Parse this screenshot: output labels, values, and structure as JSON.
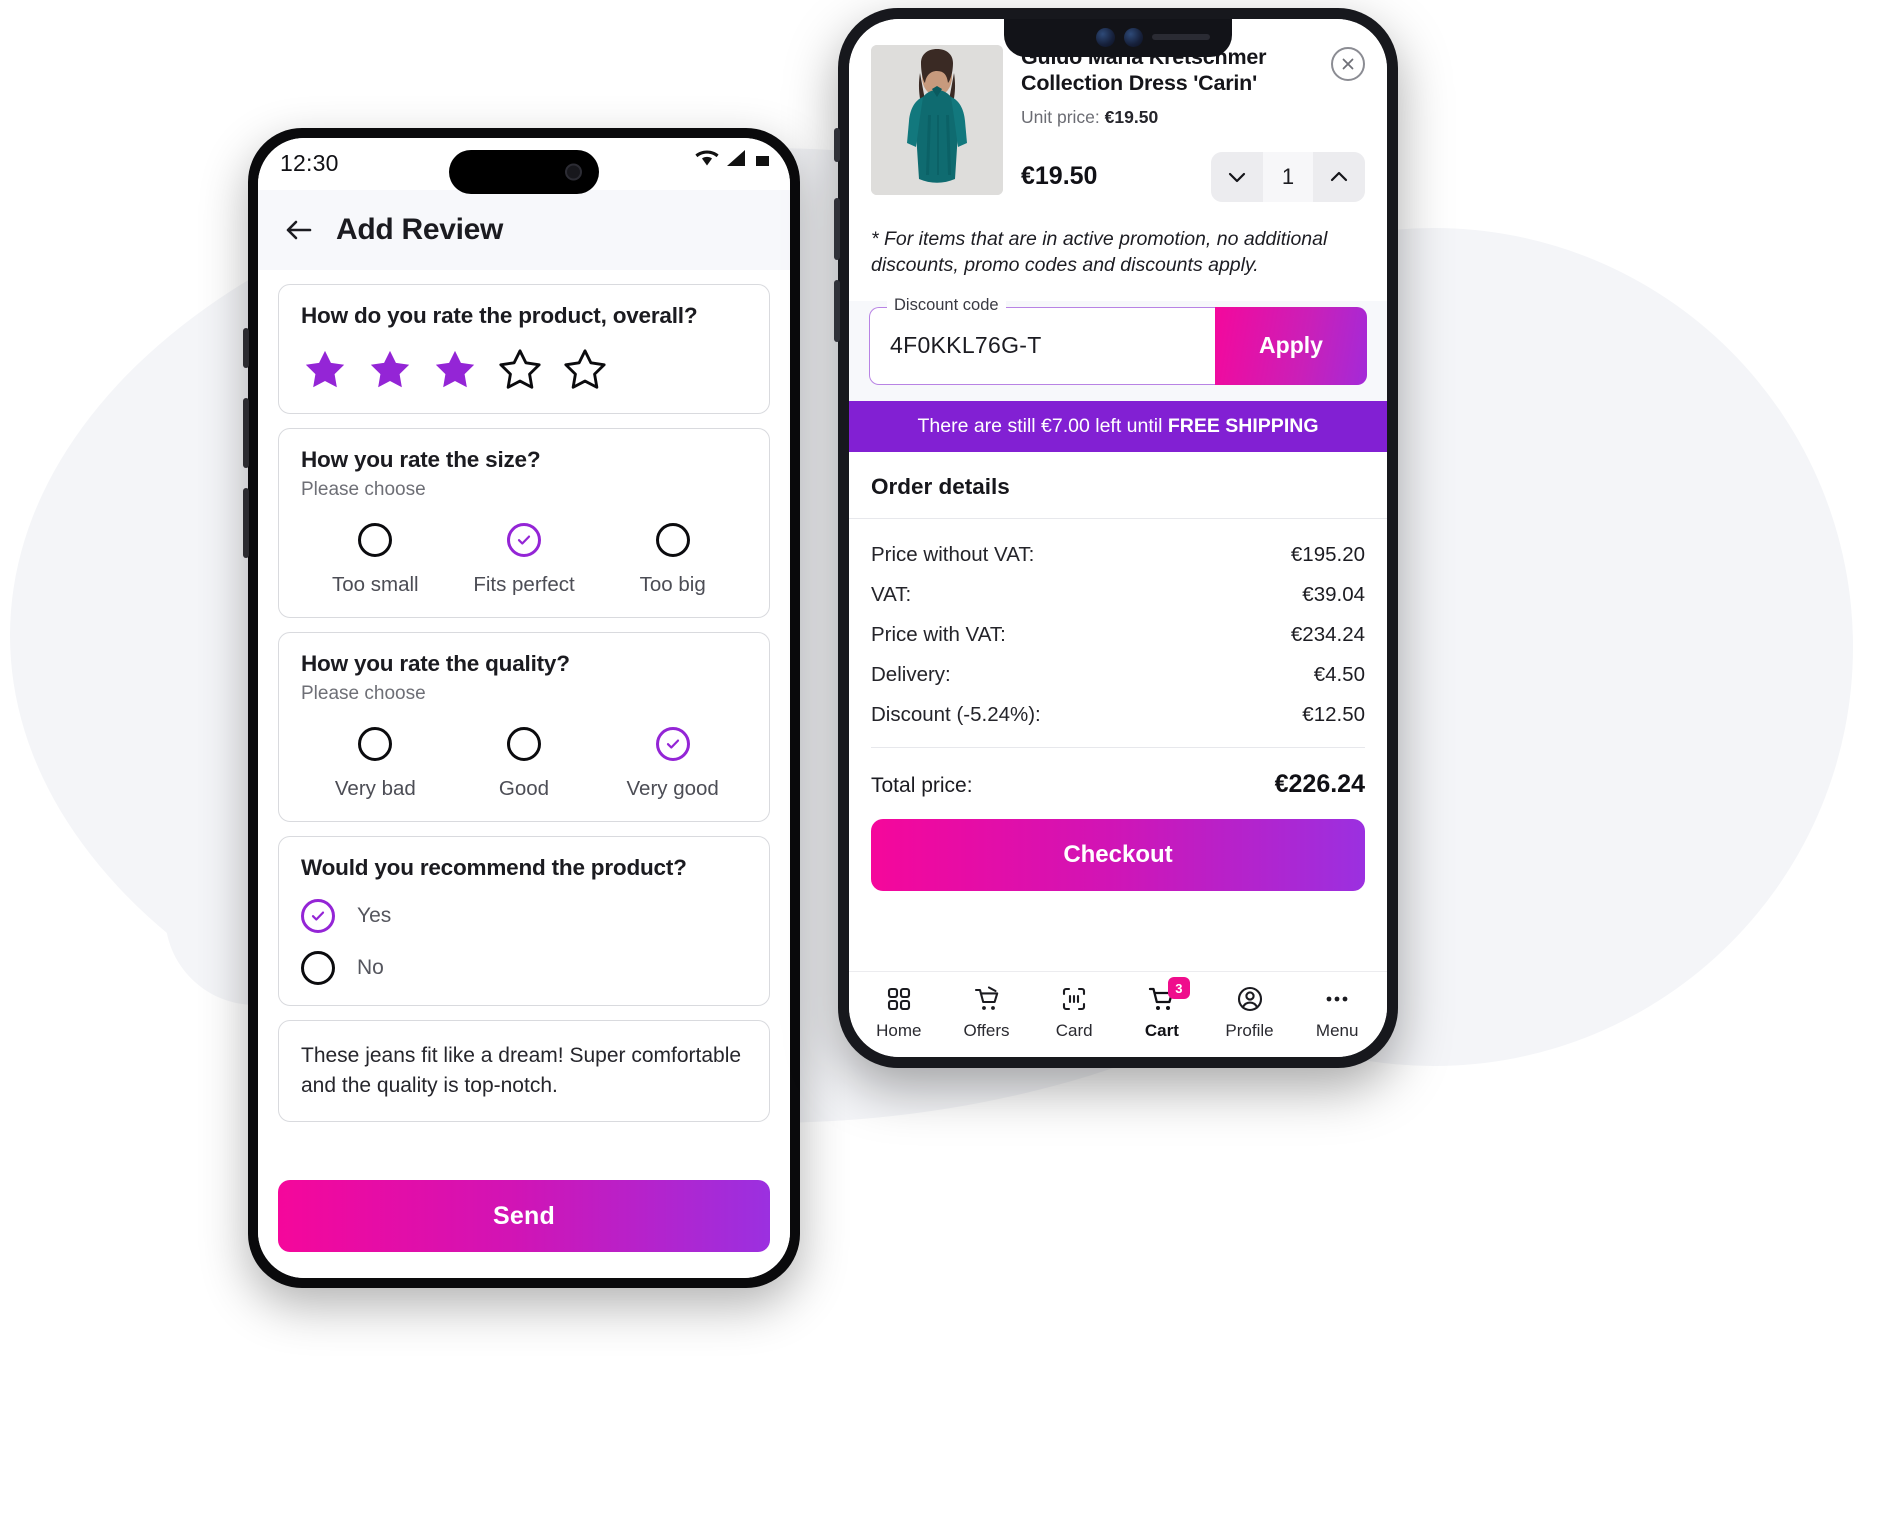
{
  "review_screen": {
    "status_bar": {
      "time": "12:30",
      "icons": [
        "wifi-icon",
        "signal-icon",
        "battery-icon"
      ]
    },
    "app_bar": {
      "back_icon": "arrow-left-icon",
      "title": "Add Review"
    },
    "overall": {
      "question": "How do you rate the product, overall?",
      "rating": 3,
      "max_rating": 5,
      "star_color": "#9425d6"
    },
    "size": {
      "question": "How you rate the size?",
      "hint": "Please choose",
      "options": [
        "Too small",
        "Fits perfect",
        "Too big"
      ],
      "selected_index": 1
    },
    "quality": {
      "question": "How you rate the quality?",
      "hint": "Please choose",
      "options": [
        "Very bad",
        "Good",
        "Very good"
      ],
      "selected_index": 2
    },
    "recommend": {
      "question": "Would you recommend the product?",
      "options": [
        "Yes",
        "No"
      ],
      "selected_index": 0
    },
    "review_text": "These jeans fit like a dream! Super comfortable and the quality is top-notch.",
    "send_label": "Send"
  },
  "cart_screen": {
    "product": {
      "name": "Guido Maria Kretschmer Collection Dress 'Carin'",
      "unit_price_label": "Unit price:",
      "unit_price": "€19.50",
      "price": "€19.50",
      "quantity": "1",
      "decrease_icon": "chevron-down-icon",
      "increase_icon": "chevron-up-icon",
      "remove_icon": "close-circle-icon"
    },
    "promo_note": "* For items that are in active promotion, no additional discounts, promo codes and discounts apply.",
    "discount": {
      "legend": "Discount code",
      "value": "4F0KKL76G-T",
      "placeholder": "Discount code",
      "apply_label": "Apply"
    },
    "shipping_banner": {
      "text_before": "There are still €7.00 left until ",
      "highlight": "FREE SHIPPING",
      "background": "#8220d3"
    },
    "order_details": {
      "title": "Order details",
      "rows": [
        {
          "label": "Price without VAT:",
          "value": "€195.20"
        },
        {
          "label": "VAT:",
          "value": "€39.04"
        },
        {
          "label": "Price with VAT:",
          "value": "€234.24"
        },
        {
          "label": "Delivery:",
          "value": "€4.50"
        },
        {
          "label": "Discount (-5.24%):",
          "value": "€12.50"
        }
      ],
      "total_label": "Total price:",
      "total_value": "€226.24"
    },
    "checkout_label": "Checkout",
    "tabs": [
      {
        "label": "Home",
        "icon": "grid-icon",
        "active": false,
        "badge": ""
      },
      {
        "label": "Offers",
        "icon": "offers-tag-icon",
        "active": false,
        "badge": ""
      },
      {
        "label": "Card",
        "icon": "scan-card-icon",
        "active": false,
        "badge": ""
      },
      {
        "label": "Cart",
        "icon": "cart-icon",
        "active": true,
        "badge": "3"
      },
      {
        "label": "Profile",
        "icon": "user-circle-icon",
        "active": false,
        "badge": ""
      },
      {
        "label": "Menu",
        "icon": "dots-icon",
        "active": false,
        "badge": ""
      }
    ]
  },
  "theme": {
    "accent_purple": "#9425d6",
    "accent_pink": "#f5079b",
    "banner_purple": "#8220d3",
    "badge_pink": "#ef0d8c"
  }
}
